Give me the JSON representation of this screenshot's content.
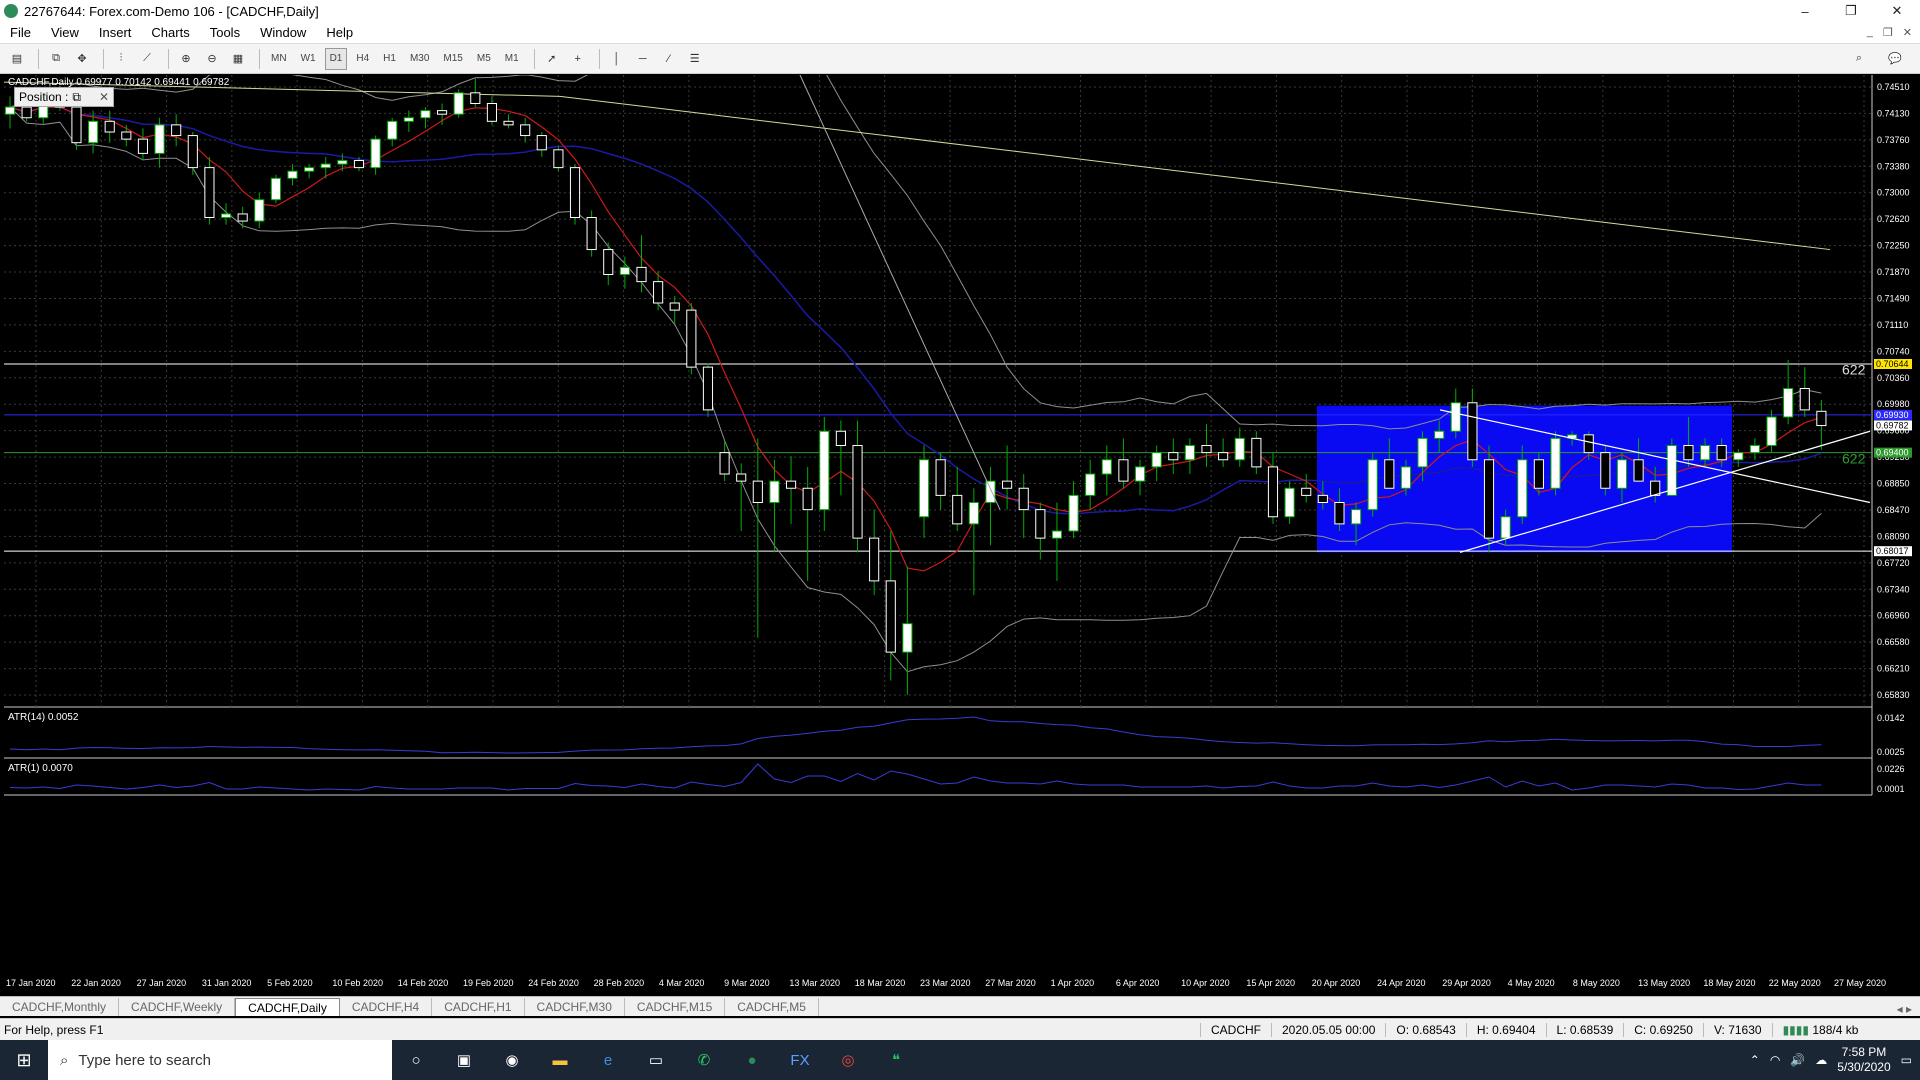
{
  "window": {
    "title": "22767644: Forex.com-Demo 106 - [CADCHF,Daily]",
    "minimize": "–",
    "restore": "❐",
    "close": "✕"
  },
  "menu": [
    "File",
    "View",
    "Insert",
    "Charts",
    "Tools",
    "Window",
    "Help"
  ],
  "toolbar": {
    "timeframes": [
      "MN",
      "W1",
      "D1",
      "H4",
      "H1",
      "M30",
      "M15",
      "M5",
      "M1"
    ],
    "active_timeframe": "D1"
  },
  "chart": {
    "symbol_line": "CADCHF,Daily  0.69977 0.70142 0.69441 0.69782",
    "position_panel": "Position :",
    "atr14_label": "ATR(14) 0.0052",
    "atr1_label": "ATR(1) 0.0070",
    "fib_label_top": "622",
    "fib_label_mid": "622",
    "price_ticks": [
      "0.74510",
      "0.74130",
      "0.73760",
      "0.73380",
      "0.73000",
      "0.72620",
      "0.72250",
      "0.71870",
      "0.71490",
      "0.71110",
      "0.70740",
      "0.70360",
      "0.69980",
      "0.69600",
      "0.69230",
      "0.68850",
      "0.68470",
      "0.68090",
      "0.67720",
      "0.67340",
      "0.66960",
      "0.66580",
      "0.66210",
      "0.65830"
    ],
    "highlight_labels": {
      "upper": "0.70644",
      "blue": "0.69930",
      "current": "0.69782",
      "green": "0.69400",
      "lower": "0.68017"
    },
    "atr14_ticks": [
      "0.0142",
      "0.0025"
    ],
    "atr1_ticks": [
      "0.0226",
      "0.0001"
    ],
    "date_ticks": [
      "17 Jan 2020",
      "22 Jan 2020",
      "27 Jan 2020",
      "31 Jan 2020",
      "5 Feb 2020",
      "10 Feb 2020",
      "14 Feb 2020",
      "19 Feb 2020",
      "24 Feb 2020",
      "28 Feb 2020",
      "4 Mar 2020",
      "9 Mar 2020",
      "13 Mar 2020",
      "18 Mar 2020",
      "23 Mar 2020",
      "27 Mar 2020",
      "1 Apr 2020",
      "6 Apr 2020",
      "10 Apr 2020",
      "15 Apr 2020",
      "20 Apr 2020",
      "24 Apr 2020",
      "29 Apr 2020",
      "4 May 2020",
      "8 May 2020",
      "13 May 2020",
      "18 May 2020",
      "22 May 2020",
      "27 May 2020"
    ]
  },
  "chart_data": {
    "type": "candlestick",
    "symbol": "CADCHF",
    "timeframe": "Daily",
    "ylim": [
      0.6583,
      0.747
    ],
    "candles": [
      {
        "o": 0.7415,
        "h": 0.744,
        "l": 0.7395,
        "c": 0.7425
      },
      {
        "o": 0.7425,
        "h": 0.7445,
        "l": 0.7405,
        "c": 0.741
      },
      {
        "o": 0.741,
        "h": 0.745,
        "l": 0.74,
        "c": 0.744
      },
      {
        "o": 0.744,
        "h": 0.7455,
        "l": 0.742,
        "c": 0.7425
      },
      {
        "o": 0.7425,
        "h": 0.7435,
        "l": 0.7365,
        "c": 0.7375
      },
      {
        "o": 0.7375,
        "h": 0.742,
        "l": 0.736,
        "c": 0.7405
      },
      {
        "o": 0.7405,
        "h": 0.742,
        "l": 0.7375,
        "c": 0.739
      },
      {
        "o": 0.739,
        "h": 0.74,
        "l": 0.737,
        "c": 0.738
      },
      {
        "o": 0.738,
        "h": 0.7395,
        "l": 0.735,
        "c": 0.736
      },
      {
        "o": 0.736,
        "h": 0.741,
        "l": 0.734,
        "c": 0.74
      },
      {
        "o": 0.74,
        "h": 0.7415,
        "l": 0.737,
        "c": 0.7385
      },
      {
        "o": 0.7385,
        "h": 0.739,
        "l": 0.733,
        "c": 0.734
      },
      {
        "o": 0.734,
        "h": 0.7355,
        "l": 0.726,
        "c": 0.727
      },
      {
        "o": 0.727,
        "h": 0.729,
        "l": 0.726,
        "c": 0.7275
      },
      {
        "o": 0.7275,
        "h": 0.7285,
        "l": 0.7255,
        "c": 0.7265
      },
      {
        "o": 0.7265,
        "h": 0.7305,
        "l": 0.7255,
        "c": 0.7295
      },
      {
        "o": 0.7295,
        "h": 0.733,
        "l": 0.729,
        "c": 0.7325
      },
      {
        "o": 0.7325,
        "h": 0.7345,
        "l": 0.7315,
        "c": 0.7335
      },
      {
        "o": 0.7335,
        "h": 0.7345,
        "l": 0.7325,
        "c": 0.734
      },
      {
        "o": 0.734,
        "h": 0.7355,
        "l": 0.7325,
        "c": 0.7345
      },
      {
        "o": 0.7345,
        "h": 0.736,
        "l": 0.7335,
        "c": 0.735
      },
      {
        "o": 0.735,
        "h": 0.7355,
        "l": 0.7335,
        "c": 0.734
      },
      {
        "o": 0.734,
        "h": 0.7385,
        "l": 0.733,
        "c": 0.738
      },
      {
        "o": 0.738,
        "h": 0.741,
        "l": 0.737,
        "c": 0.7405
      },
      {
        "o": 0.7405,
        "h": 0.742,
        "l": 0.739,
        "c": 0.741
      },
      {
        "o": 0.741,
        "h": 0.7425,
        "l": 0.7395,
        "c": 0.742
      },
      {
        "o": 0.742,
        "h": 0.743,
        "l": 0.74,
        "c": 0.7415
      },
      {
        "o": 0.7415,
        "h": 0.745,
        "l": 0.741,
        "c": 0.7445
      },
      {
        "o": 0.7445,
        "h": 0.7465,
        "l": 0.7425,
        "c": 0.743
      },
      {
        "o": 0.743,
        "h": 0.744,
        "l": 0.74,
        "c": 0.7405
      },
      {
        "o": 0.7405,
        "h": 0.7415,
        "l": 0.7395,
        "c": 0.74
      },
      {
        "o": 0.74,
        "h": 0.741,
        "l": 0.7375,
        "c": 0.7385
      },
      {
        "o": 0.7385,
        "h": 0.739,
        "l": 0.7355,
        "c": 0.7365
      },
      {
        "o": 0.7365,
        "h": 0.737,
        "l": 0.7335,
        "c": 0.734
      },
      {
        "o": 0.734,
        "h": 0.7345,
        "l": 0.726,
        "c": 0.727
      },
      {
        "o": 0.727,
        "h": 0.728,
        "l": 0.7215,
        "c": 0.7225
      },
      {
        "o": 0.7225,
        "h": 0.7235,
        "l": 0.7175,
        "c": 0.719
      },
      {
        "o": 0.719,
        "h": 0.7215,
        "l": 0.717,
        "c": 0.72
      },
      {
        "o": 0.72,
        "h": 0.7245,
        "l": 0.7165,
        "c": 0.718
      },
      {
        "o": 0.718,
        "h": 0.7195,
        "l": 0.714,
        "c": 0.715
      },
      {
        "o": 0.715,
        "h": 0.716,
        "l": 0.712,
        "c": 0.714
      },
      {
        "o": 0.714,
        "h": 0.715,
        "l": 0.705,
        "c": 0.706
      },
      {
        "o": 0.706,
        "h": 0.7065,
        "l": 0.699,
        "c": 0.7
      },
      {
        "o": 0.694,
        "h": 0.6955,
        "l": 0.69,
        "c": 0.691
      },
      {
        "o": 0.691,
        "h": 0.6925,
        "l": 0.683,
        "c": 0.69
      },
      {
        "o": 0.69,
        "h": 0.696,
        "l": 0.668,
        "c": 0.687
      },
      {
        "o": 0.687,
        "h": 0.693,
        "l": 0.68,
        "c": 0.69
      },
      {
        "o": 0.69,
        "h": 0.6935,
        "l": 0.684,
        "c": 0.689
      },
      {
        "o": 0.689,
        "h": 0.692,
        "l": 0.676,
        "c": 0.686
      },
      {
        "o": 0.686,
        "h": 0.699,
        "l": 0.683,
        "c": 0.697
      },
      {
        "o": 0.697,
        "h": 0.6985,
        "l": 0.688,
        "c": 0.695
      },
      {
        "o": 0.695,
        "h": 0.6985,
        "l": 0.68,
        "c": 0.682
      },
      {
        "o": 0.682,
        "h": 0.686,
        "l": 0.674,
        "c": 0.676
      },
      {
        "o": 0.676,
        "h": 0.683,
        "l": 0.662,
        "c": 0.666
      },
      {
        "o": 0.666,
        "h": 0.678,
        "l": 0.66,
        "c": 0.67
      },
      {
        "o": 0.685,
        "h": 0.695,
        "l": 0.682,
        "c": 0.693
      },
      {
        "o": 0.693,
        "h": 0.694,
        "l": 0.686,
        "c": 0.688
      },
      {
        "o": 0.688,
        "h": 0.692,
        "l": 0.683,
        "c": 0.684
      },
      {
        "o": 0.684,
        "h": 0.689,
        "l": 0.674,
        "c": 0.687
      },
      {
        "o": 0.687,
        "h": 0.692,
        "l": 0.681,
        "c": 0.69
      },
      {
        "o": 0.69,
        "h": 0.695,
        "l": 0.686,
        "c": 0.689
      },
      {
        "o": 0.689,
        "h": 0.691,
        "l": 0.682,
        "c": 0.686
      },
      {
        "o": 0.686,
        "h": 0.687,
        "l": 0.679,
        "c": 0.682
      },
      {
        "o": 0.682,
        "h": 0.687,
        "l": 0.676,
        "c": 0.683
      },
      {
        "o": 0.683,
        "h": 0.69,
        "l": 0.682,
        "c": 0.688
      },
      {
        "o": 0.688,
        "h": 0.693,
        "l": 0.686,
        "c": 0.691
      },
      {
        "o": 0.691,
        "h": 0.695,
        "l": 0.688,
        "c": 0.693
      },
      {
        "o": 0.693,
        "h": 0.696,
        "l": 0.689,
        "c": 0.69
      },
      {
        "o": 0.69,
        "h": 0.693,
        "l": 0.688,
        "c": 0.692
      },
      {
        "o": 0.692,
        "h": 0.695,
        "l": 0.69,
        "c": 0.694
      },
      {
        "o": 0.694,
        "h": 0.696,
        "l": 0.691,
        "c": 0.693
      },
      {
        "o": 0.693,
        "h": 0.696,
        "l": 0.691,
        "c": 0.695
      },
      {
        "o": 0.695,
        "h": 0.698,
        "l": 0.692,
        "c": 0.694
      },
      {
        "o": 0.694,
        "h": 0.696,
        "l": 0.692,
        "c": 0.693
      },
      {
        "o": 0.693,
        "h": 0.6975,
        "l": 0.692,
        "c": 0.696
      },
      {
        "o": 0.696,
        "h": 0.697,
        "l": 0.691,
        "c": 0.692
      },
      {
        "o": 0.692,
        "h": 0.694,
        "l": 0.684,
        "c": 0.685
      },
      {
        "o": 0.685,
        "h": 0.69,
        "l": 0.684,
        "c": 0.689
      },
      {
        "o": 0.689,
        "h": 0.691,
        "l": 0.687,
        "c": 0.688
      },
      {
        "o": 0.688,
        "h": 0.69,
        "l": 0.686,
        "c": 0.687
      },
      {
        "o": 0.687,
        "h": 0.689,
        "l": 0.683,
        "c": 0.684
      },
      {
        "o": 0.684,
        "h": 0.687,
        "l": 0.681,
        "c": 0.686
      },
      {
        "o": 0.686,
        "h": 0.694,
        "l": 0.685,
        "c": 0.693
      },
      {
        "o": 0.693,
        "h": 0.696,
        "l": 0.69,
        "c": 0.689
      },
      {
        "o": 0.689,
        "h": 0.693,
        "l": 0.688,
        "c": 0.692
      },
      {
        "o": 0.692,
        "h": 0.697,
        "l": 0.69,
        "c": 0.696
      },
      {
        "o": 0.696,
        "h": 0.6985,
        "l": 0.694,
        "c": 0.697
      },
      {
        "o": 0.697,
        "h": 0.703,
        "l": 0.696,
        "c": 0.701
      },
      {
        "o": 0.701,
        "h": 0.703,
        "l": 0.692,
        "c": 0.693
      },
      {
        "o": 0.693,
        "h": 0.695,
        "l": 0.68,
        "c": 0.682
      },
      {
        "o": 0.682,
        "h": 0.686,
        "l": 0.681,
        "c": 0.685
      },
      {
        "o": 0.685,
        "h": 0.695,
        "l": 0.684,
        "c": 0.693
      },
      {
        "o": 0.693,
        "h": 0.694,
        "l": 0.688,
        "c": 0.689
      },
      {
        "o": 0.689,
        "h": 0.697,
        "l": 0.688,
        "c": 0.696
      },
      {
        "o": 0.696,
        "h": 0.697,
        "l": 0.695,
        "c": 0.6965
      },
      {
        "o": 0.6965,
        "h": 0.697,
        "l": 0.693,
        "c": 0.694
      },
      {
        "o": 0.694,
        "h": 0.695,
        "l": 0.688,
        "c": 0.689
      },
      {
        "o": 0.689,
        "h": 0.694,
        "l": 0.687,
        "c": 0.693
      },
      {
        "o": 0.693,
        "h": 0.696,
        "l": 0.69,
        "c": 0.69
      },
      {
        "o": 0.69,
        "h": 0.692,
        "l": 0.687,
        "c": 0.688
      },
      {
        "o": 0.688,
        "h": 0.696,
        "l": 0.688,
        "c": 0.695
      },
      {
        "o": 0.695,
        "h": 0.699,
        "l": 0.692,
        "c": 0.693
      },
      {
        "o": 0.693,
        "h": 0.696,
        "l": 0.692,
        "c": 0.695
      },
      {
        "o": 0.695,
        "h": 0.696,
        "l": 0.692,
        "c": 0.693
      },
      {
        "o": 0.693,
        "h": 0.6945,
        "l": 0.692,
        "c": 0.694
      },
      {
        "o": 0.694,
        "h": 0.696,
        "l": 0.693,
        "c": 0.695
      },
      {
        "o": 0.695,
        "h": 0.7,
        "l": 0.694,
        "c": 0.699
      },
      {
        "o": 0.699,
        "h": 0.707,
        "l": 0.698,
        "c": 0.703
      },
      {
        "o": 0.703,
        "h": 0.706,
        "l": 0.699,
        "c": 0.7
      },
      {
        "o": 0.6998,
        "h": 0.7014,
        "l": 0.6944,
        "c": 0.6978
      }
    ]
  },
  "tabs": [
    "CADCHF,Monthly",
    "CADCHF,Weekly",
    "CADCHF,Daily",
    "CADCHF,H4",
    "CADCHF,H1",
    "CADCHF,M30",
    "CADCHF,M15",
    "CADCHF,M5"
  ],
  "active_tab": "CADCHF,Daily",
  "status": {
    "help": "For Help, press F1",
    "symbol": "CADCHF",
    "datetime": "2020.05.05 00:00",
    "open": "O: 0.68543",
    "high": "H: 0.69404",
    "low": "L: 0.68539",
    "close": "C: 0.69250",
    "volume": "V: 71630",
    "traffic": "188/4 kb"
  },
  "taskbar": {
    "search_placeholder": "Type here to search",
    "time": "7:58 PM",
    "date": "5/30/2020"
  },
  "colors": {
    "bull": "#ffffff",
    "bear": "#ffffff",
    "wick": "#00b000",
    "ma_red": "#cc1a1a",
    "ma_blue": "#1a1aa6",
    "ma_yellow": "#d8d8a0",
    "bollinger": "#8f8f8f",
    "range_box": "#0a0aff",
    "grid": "#3a3a3a"
  }
}
